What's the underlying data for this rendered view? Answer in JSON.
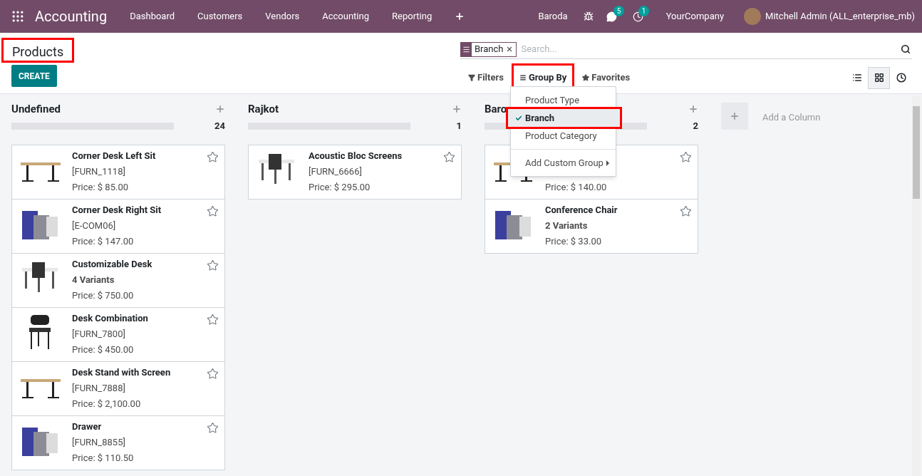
{
  "navbar": {
    "app_title": "Accounting",
    "menu": [
      "Dashboard",
      "Customers",
      "Vendors",
      "Accounting",
      "Reporting"
    ],
    "branch": "Baroda",
    "messages_count": "5",
    "activities_count": "1",
    "company": "YourCompany",
    "user": "Mitchell Admin (ALL_enterprise_mb)"
  },
  "control_panel": {
    "title": "Products",
    "title_highlighted": true,
    "create_label": "CREATE",
    "search": {
      "facet": "Branch",
      "placeholder": "Search..."
    },
    "filters": [
      {
        "kind": "filter",
        "label": "Filters",
        "highlighted": false
      },
      {
        "kind": "group",
        "label": "Group By",
        "highlighted": true
      },
      {
        "kind": "favorite",
        "label": "Favorites",
        "highlighted": false
      }
    ],
    "views": [
      {
        "kind": "list",
        "selected": false
      },
      {
        "kind": "kanban",
        "selected": true
      },
      {
        "kind": "activity",
        "selected": false
      }
    ]
  },
  "group_by_menu": {
    "items": [
      {
        "label": "Product Type",
        "selected": false,
        "highlighted": false
      },
      {
        "label": "Branch",
        "selected": true,
        "highlighted": true
      },
      {
        "label": "Product Category",
        "selected": false,
        "highlighted": false
      }
    ],
    "custom_group": "Add Custom Group"
  },
  "columns": [
    {
      "title": "Undefined",
      "count": "24",
      "level": 0,
      "cards": [
        {
          "name": "Corner Desk Left Sit",
          "detail": "[FURN_1118]",
          "price": "Price: $ 85.00"
        },
        {
          "name": "Corner Desk Right Sit",
          "detail": "[E-COM06]",
          "price": "Price: $ 147.00"
        },
        {
          "name": "Customizable Desk",
          "detail": "4 Variants",
          "price": "Price: $ 750.00"
        },
        {
          "name": "Desk Combination",
          "detail": "[FURN_7800]",
          "price": "Price: $ 450.00"
        },
        {
          "name": "Desk Stand with Screen",
          "detail": "[FURN_7888]",
          "price": "Price: $ 2,100.00"
        },
        {
          "name": "Drawer",
          "detail": "[FURN_8855]",
          "price": "Price: $ 110.50"
        }
      ]
    },
    {
      "title": "Rajkot",
      "count": "1",
      "level": 0,
      "cards": [
        {
          "name": "Acoustic Bloc Screens",
          "detail": "[FURN_6666]",
          "price": "Price: $ 295.00"
        }
      ]
    },
    {
      "title": "Baro",
      "count": "2",
      "level": 0,
      "cards": [
        {
          "price": "Price: $ 140.00"
        },
        {
          "name": "Conference Chair",
          "detail": "2 Variants",
          "price": "Price: $ 33.00"
        }
      ]
    }
  ],
  "add_column": "Add a Column"
}
